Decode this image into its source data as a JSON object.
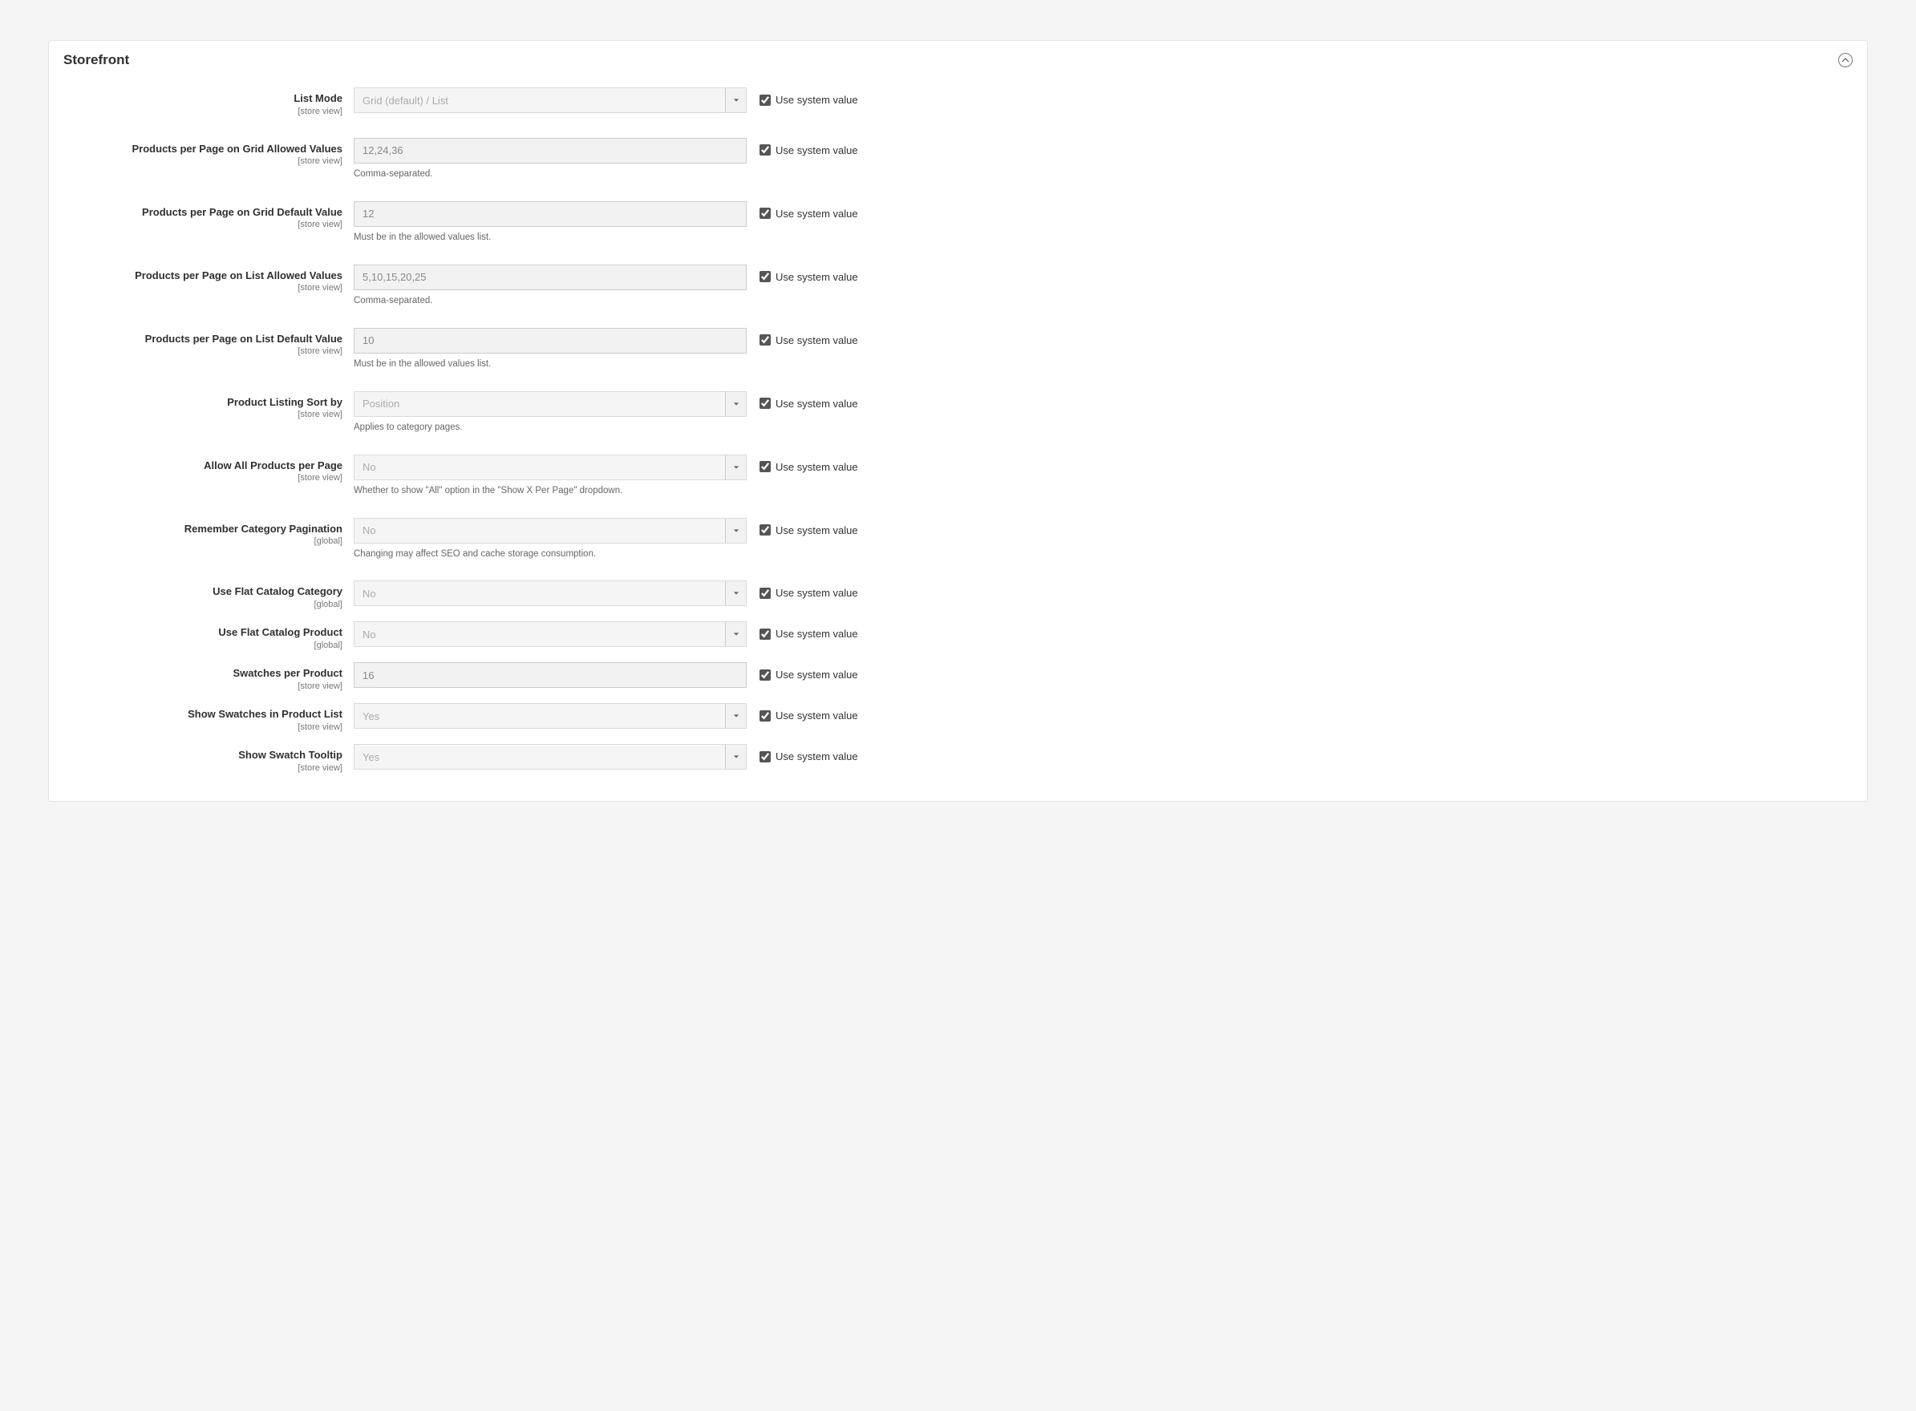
{
  "section": {
    "title": "Storefront"
  },
  "common": {
    "use_system_value": "Use system value",
    "scope_store": "[store view]",
    "scope_global": "[global]"
  },
  "fields": {
    "list_mode": {
      "label": "List Mode",
      "value": "Grid (default) / List"
    },
    "grid_allowed": {
      "label": "Products per Page on Grid Allowed Values",
      "value": "12,24,36",
      "help": "Comma-separated."
    },
    "grid_default": {
      "label": "Products per Page on Grid Default Value",
      "value": "12",
      "help": "Must be in the allowed values list."
    },
    "list_allowed": {
      "label": "Products per Page on List Allowed Values",
      "value": "5,10,15,20,25",
      "help": "Comma-separated."
    },
    "list_default": {
      "label": "Products per Page on List Default Value",
      "value": "10",
      "help": "Must be in the allowed values list."
    },
    "sort_by": {
      "label": "Product Listing Sort by",
      "value": "Position",
      "help": "Applies to category pages."
    },
    "allow_all": {
      "label": "Allow All Products per Page",
      "value": "No",
      "help": "Whether to show \"All\" option in the \"Show X Per Page\" dropdown."
    },
    "remember_pagination": {
      "label": "Remember Category Pagination",
      "value": "No",
      "help": "Changing may affect SEO and cache storage consumption."
    },
    "flat_category": {
      "label": "Use Flat Catalog Category",
      "value": "No"
    },
    "flat_product": {
      "label": "Use Flat Catalog Product",
      "value": "No"
    },
    "swatches_per_product": {
      "label": "Swatches per Product",
      "value": "16"
    },
    "swatches_in_list": {
      "label": "Show Swatches in Product List",
      "value": "Yes"
    },
    "swatch_tooltip": {
      "label": "Show Swatch Tooltip",
      "value": "Yes"
    }
  }
}
